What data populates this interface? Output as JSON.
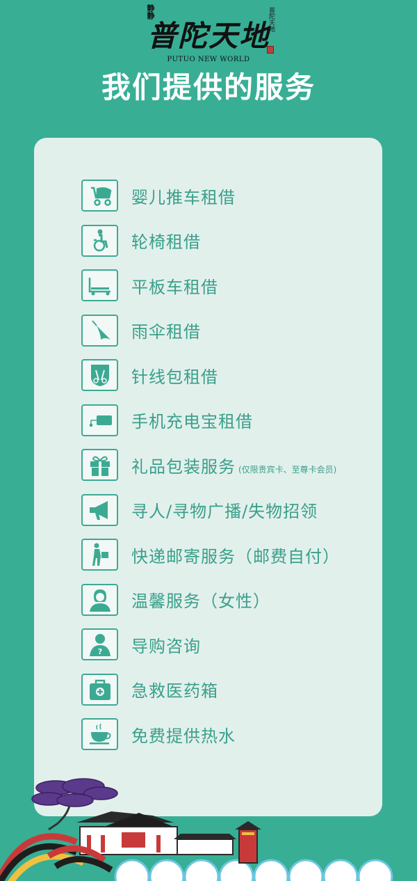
{
  "header": {
    "logo_small_left": "静静",
    "logo_main": "普陀天地",
    "logo_small_right": "普陀天地",
    "logo_sub": "PUTUO NEW WORLD",
    "title": "我们提供的服务"
  },
  "services": [
    {
      "label": "婴儿推车租借",
      "icon": "baby-stroller-icon"
    },
    {
      "label": "轮椅租借",
      "icon": "wheelchair-icon"
    },
    {
      "label": "平板车租借",
      "icon": "flat-cart-icon"
    },
    {
      "label": "雨伞租借",
      "icon": "umbrella-icon"
    },
    {
      "label": "针线包租借",
      "icon": "sewing-kit-icon"
    },
    {
      "label": "手机充电宝租借",
      "icon": "power-bank-icon"
    },
    {
      "label": "礼品包装服务",
      "note": "(仅限贵宾卡、至尊卡会员)",
      "icon": "gift-icon"
    },
    {
      "label": "寻人/寻物广播/失物招领",
      "icon": "megaphone-icon"
    },
    {
      "label": "快递邮寄服务（邮费自付）",
      "icon": "courier-icon"
    },
    {
      "label": "温馨服务（女性）",
      "icon": "woman-icon"
    },
    {
      "label": "导购咨询",
      "icon": "guide-question-icon"
    },
    {
      "label": "急救医药箱",
      "icon": "first-aid-kit-icon"
    },
    {
      "label": "免费提供热水",
      "icon": "hot-cup-icon"
    }
  ],
  "colors": {
    "background": "#38ae95",
    "card": "#e2f0ec",
    "accent": "#3a9f8a",
    "title": "#ffffff"
  }
}
